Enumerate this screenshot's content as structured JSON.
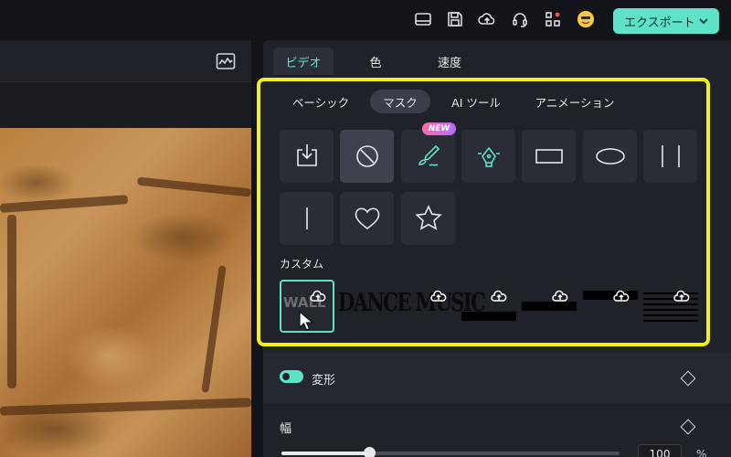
{
  "topbar": {
    "icons": [
      "layout-icon",
      "save-icon",
      "cloud-upload-icon",
      "headset-icon",
      "apps-grid-icon"
    ],
    "export_label": "エクスポート"
  },
  "panel": {
    "tabs": [
      {
        "label": "ビデオ",
        "active": true
      },
      {
        "label": "色",
        "active": false
      },
      {
        "label": "速度",
        "active": false
      }
    ],
    "subtabs": [
      {
        "label": "ベーシック",
        "active": false
      },
      {
        "label": "マスク",
        "active": true
      },
      {
        "label": "AI ツール",
        "active": false
      },
      {
        "label": "アニメーション",
        "active": false
      }
    ],
    "mask_shapes": [
      "import-mask-icon",
      "none-mask-icon",
      "brush-mask-icon",
      "pen-mask-icon",
      "rectangle-mask-icon",
      "ellipse-mask-icon",
      "double-line-mask-icon",
      "single-line-mask-icon",
      "heart-mask-icon",
      "star-mask-icon"
    ],
    "new_badge": "NEW",
    "custom_label": "カスタム",
    "custom_items": [
      {
        "text": "WALL"
      },
      {
        "text": "DANCE MUSIC"
      },
      {
        "text": ""
      },
      {
        "text": ""
      },
      {
        "text": ""
      },
      {
        "text": ""
      }
    ],
    "transform": {
      "label": "変形",
      "enabled": true
    },
    "width": {
      "label": "幅",
      "value": "100",
      "unit": "%",
      "slider_fraction": 0.26
    }
  },
  "colors": {
    "accent": "#5fe3c8",
    "highlight": "#f3f01c",
    "new_badge_start": "#ff6aa6",
    "new_badge_end": "#b26cff"
  }
}
